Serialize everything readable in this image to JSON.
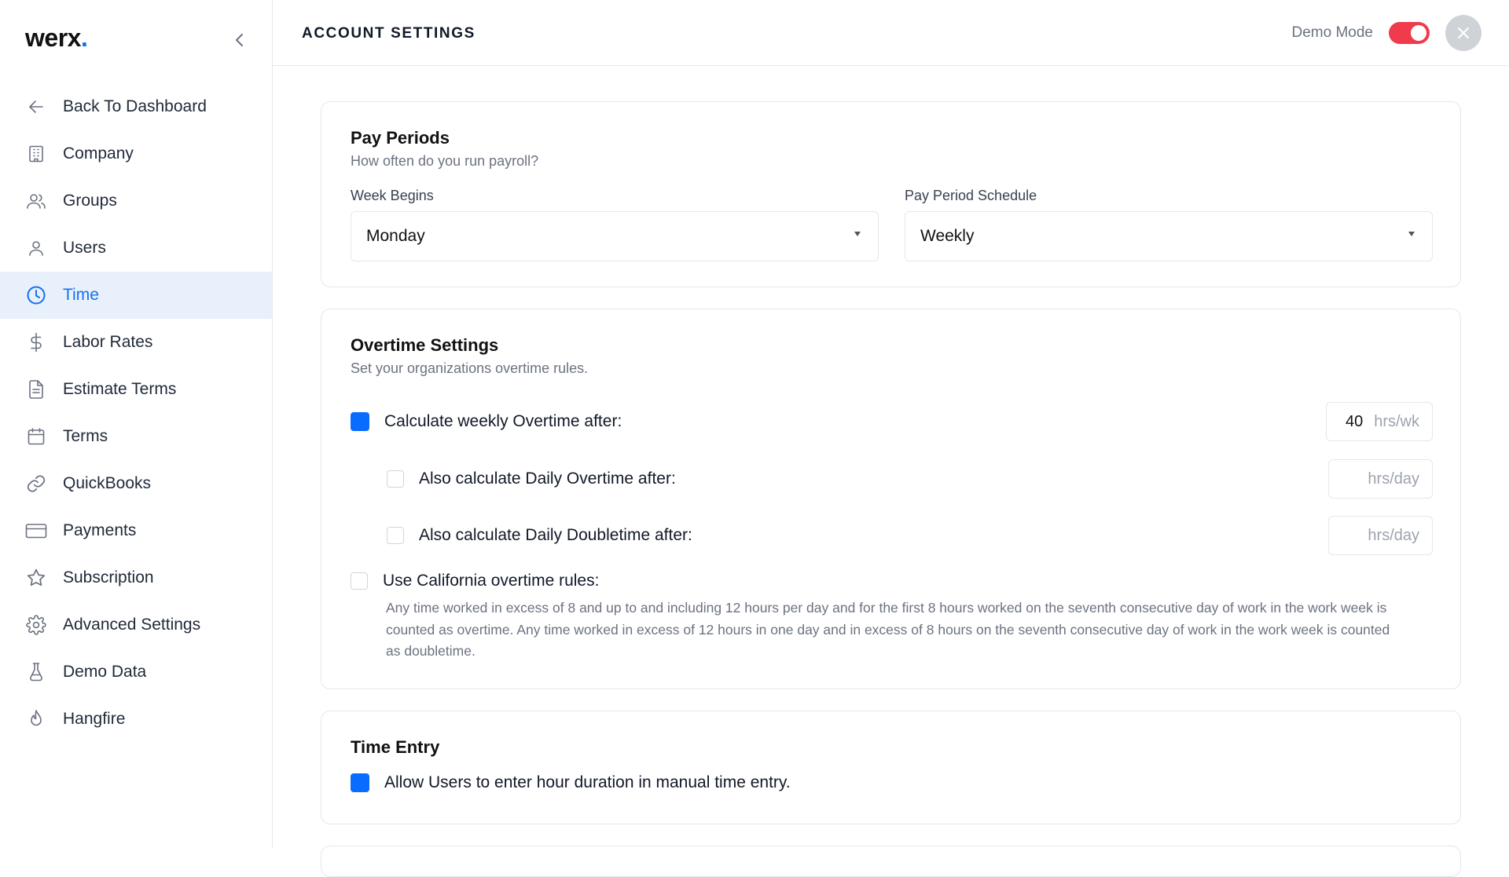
{
  "sidebar": {
    "logo_text": "werx",
    "logo_dot": ".",
    "items": [
      {
        "label": "Back To Dashboard",
        "icon": "arrow-left-icon"
      },
      {
        "label": "Company",
        "icon": "building-icon"
      },
      {
        "label": "Groups",
        "icon": "users-icon"
      },
      {
        "label": "Users",
        "icon": "user-icon"
      },
      {
        "label": "Time",
        "icon": "clock-icon",
        "active": true
      },
      {
        "label": "Labor Rates",
        "icon": "dollar-icon"
      },
      {
        "label": "Estimate Terms",
        "icon": "document-icon"
      },
      {
        "label": "Terms",
        "icon": "calendar-icon"
      },
      {
        "label": "QuickBooks",
        "icon": "link-icon"
      },
      {
        "label": "Payments",
        "icon": "credit-card-icon"
      },
      {
        "label": "Subscription",
        "icon": "star-icon"
      },
      {
        "label": "Advanced Settings",
        "icon": "gear-icon"
      },
      {
        "label": "Demo Data",
        "icon": "flask-icon"
      },
      {
        "label": "Hangfire",
        "icon": "flame-icon"
      }
    ]
  },
  "header": {
    "title": "ACCOUNT SETTINGS",
    "demo_mode_label": "Demo Mode",
    "demo_mode_on": true
  },
  "pay_periods": {
    "title": "Pay Periods",
    "subtitle": "How often do you run payroll?",
    "week_begins_label": "Week Begins",
    "week_begins_value": "Monday",
    "schedule_label": "Pay Period Schedule",
    "schedule_value": "Weekly"
  },
  "overtime": {
    "title": "Overtime Settings",
    "subtitle": "Set your organizations overtime rules.",
    "weekly_label": "Calculate weekly Overtime after:",
    "weekly_checked": true,
    "weekly_value": "40",
    "weekly_unit": "hrs/wk",
    "daily_label": "Also calculate Daily Overtime after:",
    "daily_checked": false,
    "daily_unit": "hrs/day",
    "doubletime_label": "Also calculate Daily Doubletime after:",
    "doubletime_checked": false,
    "doubletime_unit": "hrs/day",
    "california_label": "Use California overtime rules:",
    "california_checked": false,
    "california_desc": "Any time worked in excess of 8 and up to and including 12 hours per day and for the first 8 hours worked on the seventh consecutive day of work in the work week is counted as overtime. Any time worked in excess of 12 hours in one day and in excess of 8 hours on the seventh consecutive day of work in the work week is counted as doubletime."
  },
  "time_entry": {
    "title": "Time Entry",
    "duration_label": "Allow Users to enter hour duration in manual time entry.",
    "duration_checked": true
  },
  "colors": {
    "accent": "#0a6cff",
    "active_bg": "#e8f0fb",
    "toggle_on": "#ef3b4c"
  }
}
